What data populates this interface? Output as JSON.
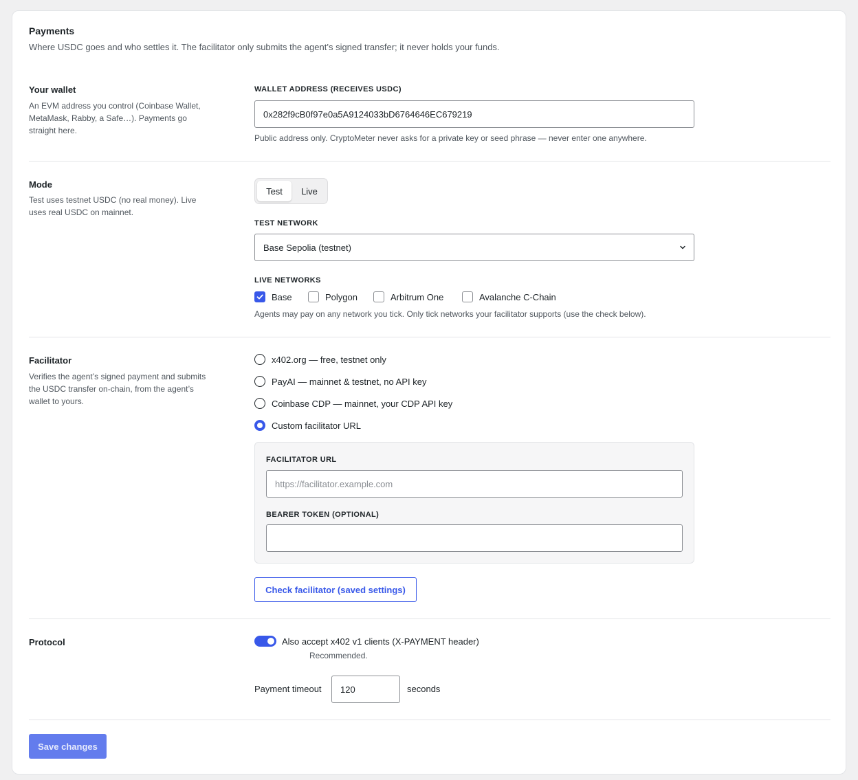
{
  "header": {
    "title": "Payments",
    "description": "Where USDC goes and who settles it. The facilitator only submits the agent’s signed transfer; it never holds your funds."
  },
  "wallet": {
    "title": "Your wallet",
    "description": "An EVM address you control (Coinbase Wallet, MetaMask, Rabby, a Safe…). Payments go straight here.",
    "field_label": "Wallet address (receives USDC)",
    "address_value": "0x282f9cB0f97e0a5A9124033bD6764646EC679219",
    "help": "Public address only. CryptoMeter never asks for a private key or seed phrase — never enter one anywhere."
  },
  "mode": {
    "title": "Mode",
    "description": "Test uses testnet USDC (no real money). Live uses real USDC on mainnet.",
    "options": [
      "Test",
      "Live"
    ],
    "selected": "Test",
    "test_network_label": "Test network",
    "test_network_value": "Base Sepolia (testnet)",
    "live_networks_label": "Live networks",
    "live_networks": [
      {
        "label": "Base",
        "checked": true
      },
      {
        "label": "Polygon",
        "checked": false
      },
      {
        "label": "Arbitrum One",
        "checked": false
      },
      {
        "label": "Avalanche C-Chain",
        "checked": false
      }
    ],
    "help": "Agents may pay on any network you tick. Only tick networks your facilitator supports (use the check below)."
  },
  "facilitator": {
    "title": "Facilitator",
    "description": "Verifies the agent’s signed payment and submits the USDC transfer on-chain, from the agent’s wallet to yours.",
    "options": [
      {
        "label": "x402.org — free, testnet only",
        "selected": false
      },
      {
        "label": "PayAI — mainnet & testnet, no API key",
        "selected": false
      },
      {
        "label": "Coinbase CDP — mainnet, your CDP API key",
        "selected": false
      },
      {
        "label": "Custom facilitator URL",
        "selected": true
      }
    ],
    "url_label": "Facilitator URL",
    "url_placeholder": "https://facilitator.example.com",
    "url_value": "",
    "token_label": "Bearer token (optional)",
    "token_value": "",
    "check_button": "Check facilitator (saved settings)"
  },
  "protocol": {
    "title": "Protocol",
    "toggle_label": "Also accept x402 v1 clients (X-PAYMENT header)",
    "toggle_on": true,
    "toggle_note": "Recommended.",
    "timeout_label": "Payment timeout",
    "timeout_value": "120",
    "timeout_unit": "seconds"
  },
  "footer": {
    "save_label": "Save changes"
  },
  "colors": {
    "accent": "#3858e9",
    "background": "#f0f0f1",
    "card": "#ffffff"
  }
}
